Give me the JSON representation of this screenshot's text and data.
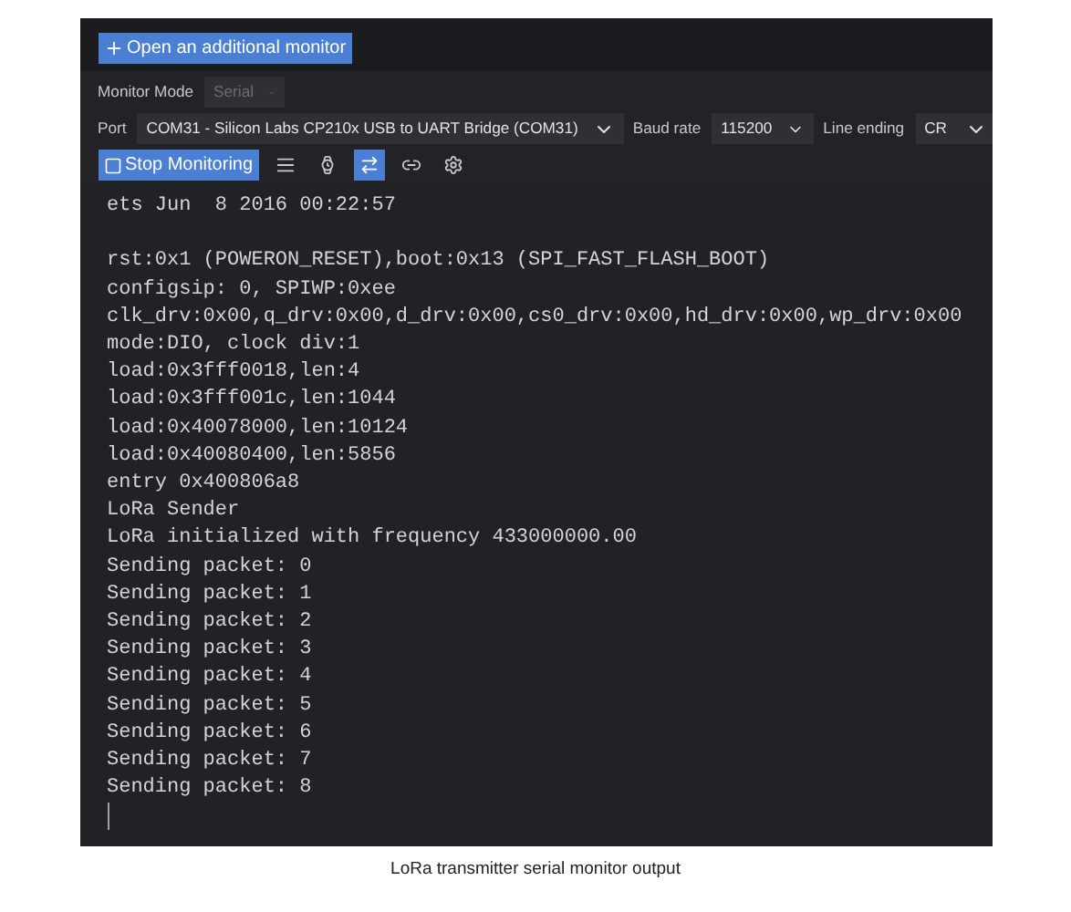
{
  "open_monitor_button": "Open an additional monitor",
  "monitor_mode": {
    "label": "Monitor Mode",
    "value": "Serial",
    "disabled": true
  },
  "port": {
    "label": "Port",
    "value": "COM31 - Silicon Labs CP210x USB to UART Bridge (COM31)"
  },
  "baud_rate": {
    "label": "Baud rate",
    "value": "115200"
  },
  "line_ending": {
    "label": "Line ending",
    "value": "CR"
  },
  "stop_button": "Stop Monitoring",
  "tool_buttons": [
    {
      "kind": "lines",
      "selected": false
    },
    {
      "kind": "timestamp",
      "selected": false
    },
    {
      "kind": "autoscroll",
      "selected": true
    },
    {
      "kind": "link",
      "selected": false
    },
    {
      "kind": "settings",
      "selected": false
    }
  ],
  "output_lines": [
    "ets Jun  8 2016 00:22:57",
    {
      "text": "rst:0x1 (POWERON_RESET),boot:0x13 (SPI_FAST_FLASH_BOOT)",
      "blank_line_before": true
    },
    "configsip: 0, SPIWP:0xee",
    "clk_drv:0x00,q_drv:0x00,d_drv:0x00,cs0_drv:0x00,hd_drv:0x00,wp_drv:0x00",
    "mode:DIO, clock div:1",
    "load:0x3fff0018,len:4",
    "load:0x3fff001c,len:1044",
    "load:0x40078000,len:10124",
    "load:0x40080400,len:5856",
    "entry 0x400806a8",
    "LoRa Sender",
    "LoRa initialized with frequency 433000000.00",
    "Sending packet: 0",
    "Sending packet: 1",
    "Sending packet: 2",
    "Sending packet: 3",
    "Sending packet: 4",
    "Sending packet: 5",
    "Sending packet: 6",
    "Sending packet: 7",
    "Sending packet: 8"
  ],
  "caption": "LoRa transmitter serial monitor output"
}
